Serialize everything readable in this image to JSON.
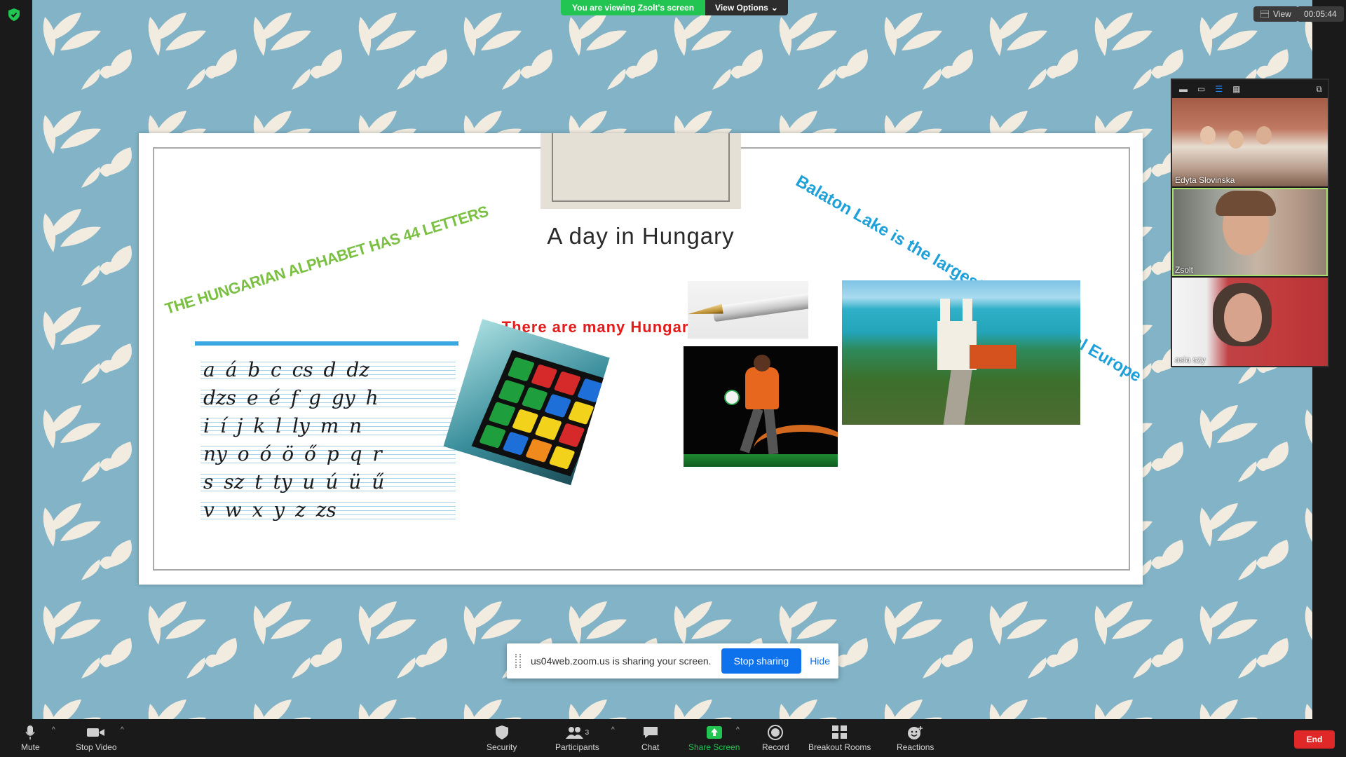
{
  "top_bar": {
    "viewing_label": "You are viewing Zsolt's screen",
    "view_options_label": "View Options",
    "view_label": "View",
    "timer": "00:05:44"
  },
  "slide": {
    "title": "A day in Hungary",
    "alphabet_heading": "THE HUNGARIAN ALPHABET HAS 44 LETTERS",
    "balaton_heading": "Balaton Lake is the largest lake in Central Europe",
    "inventions_heading": "There are many Hungarian inventions",
    "alphabet_rows": [
      "a á b c cs d dz",
      "dzs e é f g gy h",
      "i í j k l ly m n",
      "ny o ó ö ő p q r",
      "s sz t ty u ú ü ű",
      "v w x y z zs"
    ]
  },
  "share_bar": {
    "message": "us04web.zoom.us is sharing your screen.",
    "stop_label": "Stop sharing",
    "hide_label": "Hide"
  },
  "participants_panel": {
    "tiles": [
      {
        "name": "Edyta Slovinska"
      },
      {
        "name": "Zsolt"
      },
      {
        "name": "asia szy"
      }
    ]
  },
  "toolbar": {
    "mute": "Mute",
    "stop_video": "Stop Video",
    "security": "Security",
    "participants": "Participants",
    "participants_count": "3",
    "chat": "Chat",
    "share_screen": "Share Screen",
    "record": "Record",
    "breakout_rooms": "Breakout Rooms",
    "reactions": "Reactions",
    "end": "End"
  },
  "colors": {
    "accent_green": "#23c552",
    "accent_blue": "#0e72ed",
    "end_red": "#e02828",
    "background_teal": "#7fb0c4",
    "alphabet_green": "#7bc043",
    "balaton_blue": "#1fa0d8",
    "inventions_red": "#e41b1b"
  }
}
